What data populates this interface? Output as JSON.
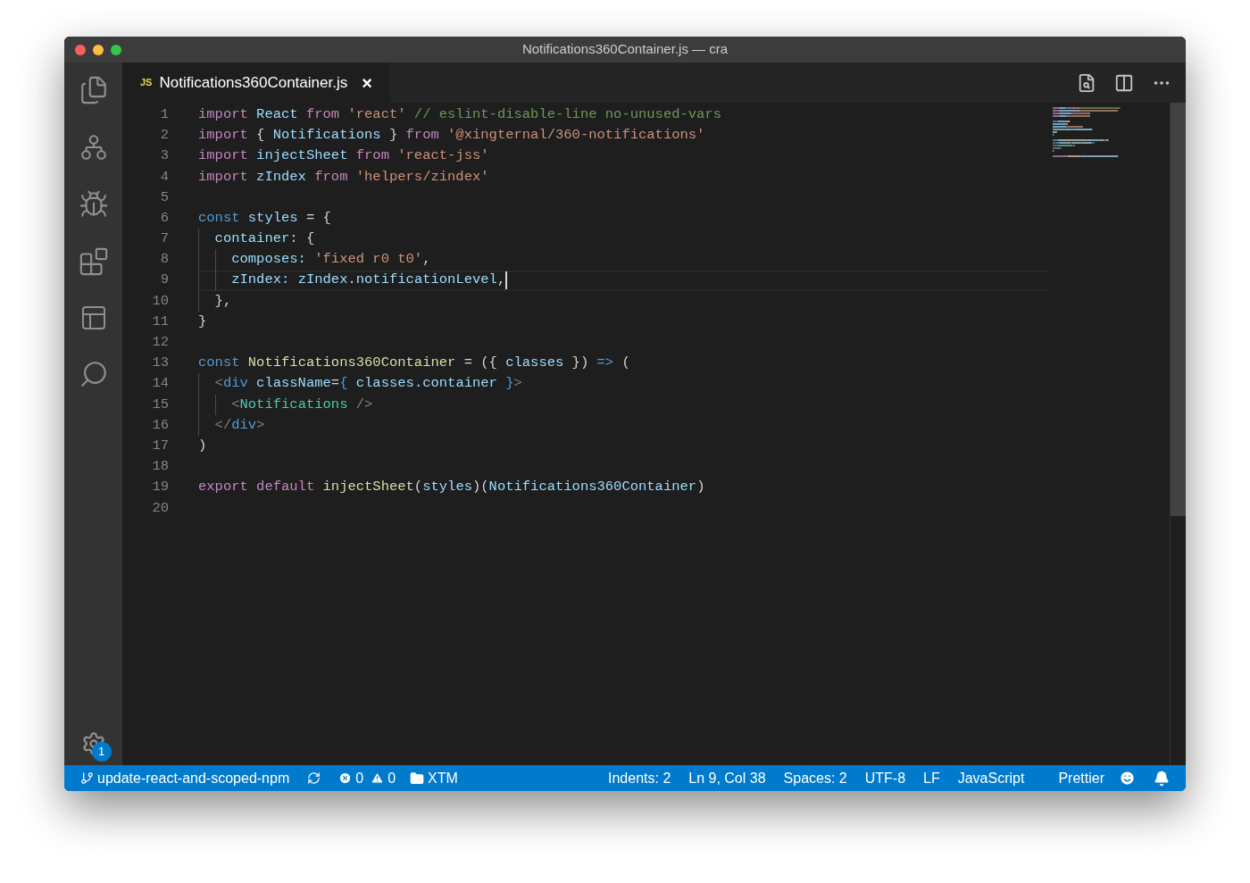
{
  "window": {
    "title": "Notifications360Container.js — cra"
  },
  "activity_bar": {
    "settings_badge": "1"
  },
  "tabs": [
    {
      "icon_label": "JS",
      "label": "Notifications360Container.js",
      "close": "×",
      "selected": true
    }
  ],
  "editor": {
    "lines": [
      {
        "number": "1",
        "current": false,
        "tokens": [
          {
            "kind": "keyword",
            "text": "import"
          },
          {
            "kind": "variable",
            "text": " React"
          },
          {
            "kind": "keyword",
            "text": " from"
          },
          {
            "kind": "string",
            "text": " 'react'"
          },
          {
            "kind": "comment",
            "text": " // eslint-disable-line no-unused-vars"
          }
        ]
      },
      {
        "number": "2",
        "current": false,
        "tokens": [
          {
            "kind": "keyword",
            "text": "import"
          },
          {
            "kind": "plain",
            "text": " { "
          },
          {
            "kind": "variable",
            "text": "Notifications"
          },
          {
            "kind": "plain",
            "text": " } "
          },
          {
            "kind": "keyword",
            "text": "from"
          },
          {
            "kind": "string",
            "text": " '@xingternal/360-notifications'"
          }
        ]
      },
      {
        "number": "3",
        "current": false,
        "tokens": [
          {
            "kind": "keyword",
            "text": "import"
          },
          {
            "kind": "variable",
            "text": " injectSheet"
          },
          {
            "kind": "keyword",
            "text": " from"
          },
          {
            "kind": "string",
            "text": " 'react-jss'"
          }
        ]
      },
      {
        "number": "4",
        "current": false,
        "tokens": [
          {
            "kind": "keyword",
            "text": "import"
          },
          {
            "kind": "variable",
            "text": " zIndex"
          },
          {
            "kind": "keyword",
            "text": " from"
          },
          {
            "kind": "string",
            "text": " 'helpers/zindex'"
          }
        ]
      },
      {
        "number": "5",
        "current": false
      },
      {
        "number": "6",
        "current": false,
        "tokens": [
          {
            "kind": "storage",
            "text": "const"
          },
          {
            "kind": "variable",
            "text": " styles"
          },
          {
            "kind": "plain",
            "text": " = {"
          }
        ]
      },
      {
        "number": "7",
        "current": false,
        "tokens": [
          {
            "kind": "variable",
            "text": "  container:"
          },
          {
            "kind": "plain",
            "text": " {"
          }
        ]
      },
      {
        "number": "8",
        "current": false,
        "tokens": [
          {
            "kind": "variable",
            "text": "    composes:"
          },
          {
            "kind": "string",
            "text": " 'fixed r0 t0'"
          },
          {
            "kind": "plain",
            "text": ","
          }
        ]
      },
      {
        "number": "9",
        "current": true,
        "tokens": [
          {
            "kind": "variable",
            "text": "    zIndex:"
          },
          {
            "kind": "variable",
            "text": " zIndex"
          },
          {
            "kind": "plain",
            "text": "."
          },
          {
            "kind": "variable",
            "text": "notificationLevel"
          },
          {
            "kind": "plain",
            "text": ","
          }
        ]
      },
      {
        "number": "10",
        "current": false,
        "tokens": [
          {
            "kind": "plain",
            "text": "  },"
          }
        ]
      },
      {
        "number": "11",
        "current": false,
        "tokens": [
          {
            "kind": "plain",
            "text": "}"
          }
        ]
      },
      {
        "number": "12",
        "current": false
      },
      {
        "number": "13",
        "current": false,
        "tokens": [
          {
            "kind": "storage",
            "text": "const"
          },
          {
            "kind": "function",
            "text": " Notifications360Container"
          },
          {
            "kind": "plain",
            "text": " = ({ "
          },
          {
            "kind": "variable",
            "text": "classes"
          },
          {
            "kind": "plain",
            "text": " }) "
          },
          {
            "kind": "storage",
            "text": "=>"
          },
          {
            "kind": "plain",
            "text": " ("
          }
        ]
      },
      {
        "number": "14",
        "current": false,
        "tokens": [
          {
            "kind": "punctuation",
            "text": "  <"
          },
          {
            "kind": "storage",
            "text": "div"
          },
          {
            "kind": "variable",
            "text": " className"
          },
          {
            "kind": "plain",
            "text": "="
          },
          {
            "kind": "storage",
            "text": "{"
          },
          {
            "kind": "variable",
            "text": " classes"
          },
          {
            "kind": "plain",
            "text": "."
          },
          {
            "kind": "variable",
            "text": "container"
          },
          {
            "kind": "storage",
            "text": " }"
          },
          {
            "kind": "punctuation",
            "text": ">"
          }
        ]
      },
      {
        "number": "15",
        "current": false,
        "tokens": [
          {
            "kind": "punctuation",
            "text": "    <"
          },
          {
            "kind": "component",
            "text": "Notifications"
          },
          {
            "kind": "punctuation",
            "text": " />"
          }
        ]
      },
      {
        "number": "16",
        "current": false,
        "tokens": [
          {
            "kind": "punctuation",
            "text": "  </"
          },
          {
            "kind": "storage",
            "text": "div"
          },
          {
            "kind": "punctuation",
            "text": ">"
          }
        ]
      },
      {
        "number": "17",
        "current": false,
        "tokens": [
          {
            "kind": "plain",
            "text": ")"
          }
        ]
      },
      {
        "number": "18",
        "current": false
      },
      {
        "number": "19",
        "current": false,
        "tokens": [
          {
            "kind": "keyword",
            "text": "export"
          },
          {
            "kind": "keyword",
            "text": " default"
          },
          {
            "kind": "function",
            "text": " injectSheet"
          },
          {
            "kind": "plain",
            "text": "("
          },
          {
            "kind": "variable",
            "text": "styles"
          },
          {
            "kind": "plain",
            "text": ")("
          },
          {
            "kind": "variable",
            "text": "Notifications360Container"
          },
          {
            "kind": "plain",
            "text": ")"
          }
        ]
      },
      {
        "number": "20",
        "current": false
      }
    ]
  },
  "status_bar": {
    "left": [
      {
        "kind": "branch",
        "text": "update-react-and-scoped-npm"
      },
      {
        "kind": "sync"
      },
      {
        "kind": "errors",
        "text": "0"
      },
      {
        "kind": "warnings",
        "text": "0"
      },
      {
        "kind": "folder",
        "text": "XTM"
      }
    ],
    "right": [
      "Indents: 2",
      "Ln 9, Col 38",
      "Spaces: 2",
      "UTF-8",
      "LF",
      "JavaScript",
      "Prettier"
    ]
  }
}
